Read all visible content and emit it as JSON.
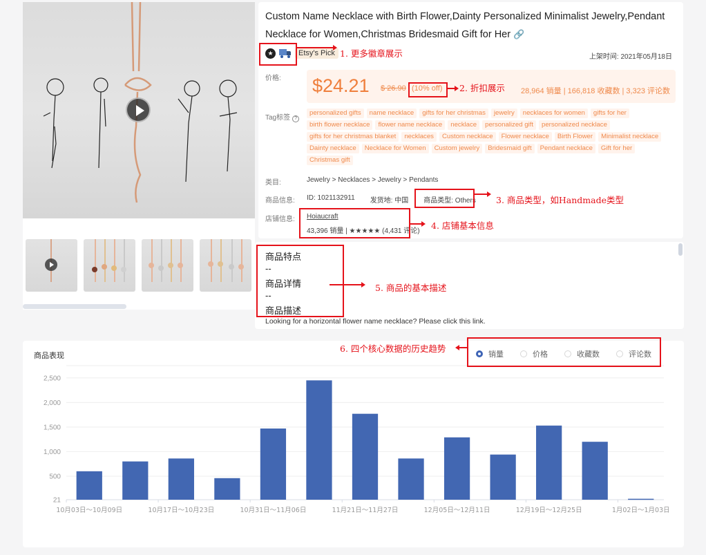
{
  "product": {
    "title": "Custom Name Necklace with Birth Flower,Dainty Personalized Minimalist Jewelry,Pendant Necklace for Women,Christmas Bridesmaid Gift for Her",
    "link_icon": "link-icon",
    "badges": [
      "star-badge-icon",
      "truck-icon"
    ],
    "badge_label": "Etsy's Pick",
    "listed_date": "上架时间: 2021年05月18日",
    "price_label": "价格:",
    "price": "$24.21",
    "price_original": "$ 26.90",
    "discount": "(10% off)",
    "stats": "28,964 销量 | 166,818 收藏数 | 3,323 评论数",
    "tags_label": "Tag标签",
    "tags": [
      "personalized gifts",
      "name necklace",
      "gifts for her christmas",
      "jewelry",
      "necklaces for women",
      "gifts for her",
      "birth flower necklace",
      "flower name necklace",
      "necklace",
      "personalized gift",
      "personalized necklace",
      "gifts for her christmas blanket",
      "necklaces",
      "Custom necklace",
      "Flower necklace",
      "Birth Flower",
      "Minimalist necklace",
      "Dainty necklace",
      "Necklace for Women",
      "Custom jewelry",
      "Bridesmaid gift",
      "Pendant necklace",
      "Gift for her",
      "Christmas gift"
    ],
    "category_label": "类目:",
    "category": "Jewelry  > Necklaces > Jewelry > Pendants",
    "info_label": "商品信息:",
    "id": "ID: 1021132911",
    "ship_from": "发货地: 中国",
    "product_type": "商品类型: Others",
    "shop_label": "店铺信息:",
    "shop_name": "Hoiaucraft",
    "shop_stats": "43,396 销量 | ★★★★★ (4,431 评论)"
  },
  "description": {
    "lines": [
      "商品特点",
      "--",
      "商品详情",
      "--",
      "商品描述"
    ],
    "text": "Looking for a horizontal flower name necklace? Please click this link."
  },
  "performance": {
    "title": "商品表现",
    "options": [
      {
        "label": "销量",
        "selected": true
      },
      {
        "label": "价格",
        "selected": false
      },
      {
        "label": "收藏数",
        "selected": false
      },
      {
        "label": "评论数",
        "selected": false
      }
    ]
  },
  "annotations": [
    "1. 更多徽章展示",
    "2. 折扣展示",
    "3. 商品类型，如Handmade类型",
    "4. 店铺基本信息",
    "5. 商品的基本描述",
    "6. 四个核心数据的历史趋势"
  ],
  "colors": {
    "accent": "#ef8a4c",
    "bar": "#4267b2",
    "annotation": "#e5121a"
  },
  "chart_data": {
    "type": "bar",
    "title": "商品表现",
    "series": [
      {
        "name": "销量",
        "values": [
          600,
          800,
          860,
          460,
          1470,
          2450,
          1770,
          860,
          1290,
          940,
          1530,
          1200,
          40
        ]
      }
    ],
    "categories": [
      "10月03日～10月09日",
      "",
      "10月17日～10月23日",
      "",
      "10月31日～11月06日",
      "",
      "11月21日～11月27日",
      "",
      "12月05日～12月11日",
      "",
      "12月19日～12月25日",
      "",
      "1月02日～1月03日"
    ],
    "yticks": [
      "21",
      "500",
      "1,000",
      "1,500",
      "2,000",
      "2,500"
    ],
    "ytick_values": [
      21,
      500,
      1000,
      1500,
      2000,
      2500
    ],
    "ylim": [
      21,
      2750
    ],
    "xlabel": "",
    "ylabel": "",
    "grid": true,
    "legend": "none"
  }
}
